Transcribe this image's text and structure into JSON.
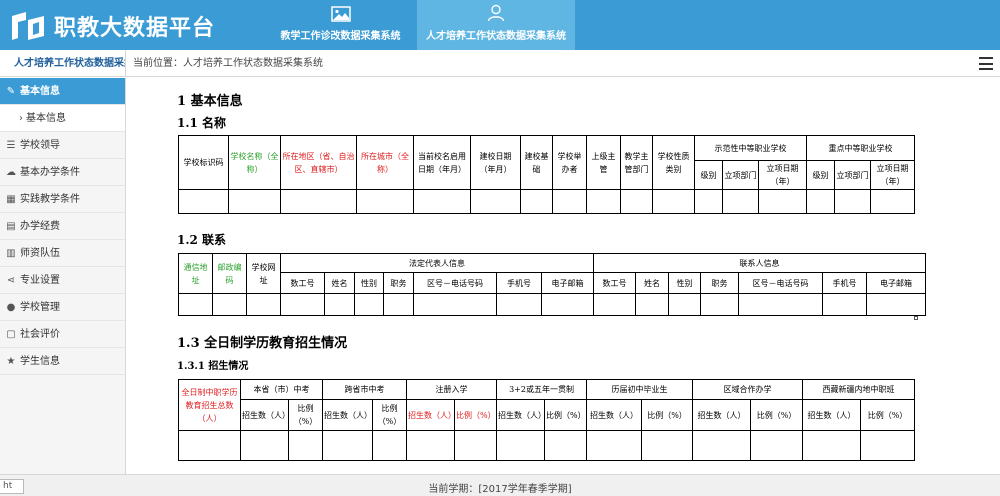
{
  "header": {
    "logo_text": "职教大数据平台",
    "tabs": [
      {
        "label": "教学工作诊改数据采集系统",
        "icon": "image-icon",
        "active": false
      },
      {
        "label": "人才培养工作状态数据采集系统",
        "icon": "user-icon",
        "active": true
      }
    ]
  },
  "subbar": {
    "system_title": "人才培养工作状态数据采集",
    "breadcrumb": "当前位置：人才培养工作状态数据采集系统"
  },
  "sidebar": {
    "items": [
      {
        "label": "基本信息",
        "icon": "edit-icon",
        "active": true
      },
      {
        "label": "基本信息",
        "sub": true
      },
      {
        "label": "学校领导",
        "icon": "list-icon"
      },
      {
        "label": "基本办学条件",
        "icon": "cloud-icon"
      },
      {
        "label": "实践教学条件",
        "icon": "grid-icon"
      },
      {
        "label": "办学经费",
        "icon": "document-icon"
      },
      {
        "label": "师资队伍",
        "icon": "book-icon"
      },
      {
        "label": "专业设置",
        "icon": "share-icon"
      },
      {
        "label": "学校管理",
        "icon": "users-icon"
      },
      {
        "label": "社会评价",
        "icon": "comment-icon"
      },
      {
        "label": "学生信息",
        "icon": "star-icon"
      }
    ]
  },
  "content": {
    "section1": "1   基本信息",
    "s11": "1.1  名称",
    "t1": {
      "school_code": "学校标识码",
      "school_name": "学校名称（全称）",
      "region": "所在地区（省、自治区、直辖市）",
      "city": "所在城市（全称）",
      "approved_date": "当前校名启用日期（年月）",
      "founded_date": "建校日期（年月）",
      "basis": "建校基础",
      "organizer": "学校举办者",
      "superior": "上级主管",
      "edu_dept": "教学主管部门",
      "school_type": "学校性质类别",
      "demo_group": "示范性中等职业学校",
      "key_group": "重点中等职业学校",
      "level": "级别",
      "project_dept": "立项部门",
      "project_date": "立项日期（年）"
    },
    "s12": "1.2  联系",
    "t2": {
      "address": "通信地址",
      "postcode": "邮政编码",
      "website": "学校网址",
      "legal_rep": "法定代表人信息",
      "contact": "联系人信息",
      "id_no": "数工号",
      "name": "姓名",
      "gender": "性别",
      "position": "职务",
      "area_phone": "区号－电话号码",
      "mobile": "手机号",
      "email": "电子邮箱"
    },
    "s13": "1.3  全日制学历教育招生情况",
    "s131": "1.3.1 招生情况",
    "t3": {
      "total": "全日制中职学历教育招生总数（人）",
      "local_hs": "本省（市）中考",
      "other_hs": "跨省市中考",
      "reg": "注册入学",
      "five_year": "3+2或五年一贯制",
      "junior": "历届初中毕业生",
      "coop": "区域合作办学",
      "xinjiang": "西藏新疆内地中职班",
      "count": "招生数（人）",
      "ratio": "比例（%）"
    }
  },
  "footer": {
    "term": "当前学期：[2017学年春季学期]",
    "tag": "ht"
  }
}
